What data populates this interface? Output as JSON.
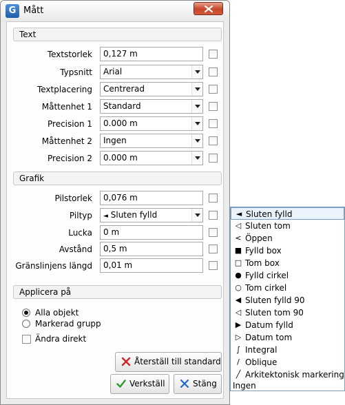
{
  "window": {
    "title": "Mått",
    "app_icon_letter": "G"
  },
  "sections": {
    "text": "Text",
    "grafik": "Grafik",
    "applicera": "Applicera på"
  },
  "text_rows": {
    "textstorlek": {
      "label": "Textstorlek",
      "value": "0,127 m"
    },
    "typsnitt": {
      "label": "Typsnitt",
      "value": "Arial"
    },
    "textplacering": {
      "label": "Textplacering",
      "value": "Centrerad"
    },
    "mattenhet1": {
      "label": "Måttenhet 1",
      "value": "Standard"
    },
    "precision1": {
      "label": "Precision 1",
      "value": "0.000 m"
    },
    "mattenhet2": {
      "label": "Måttenhet 2",
      "value": "Ingen"
    },
    "precision2": {
      "label": "Precision 2",
      "value": "0.000 m"
    }
  },
  "grafik_rows": {
    "pilstorlek": {
      "label": "Pilstorlek",
      "value": "0,076 m"
    },
    "piltyp": {
      "label": "Piltyp",
      "value": "Sluten fylld",
      "icon": "◄"
    },
    "lucka": {
      "label": "Lucka",
      "value": "0 m"
    },
    "avstand": {
      "label": "Avstånd",
      "value": "0,5 m"
    },
    "granslinje": {
      "label": "Gränslinjens längd",
      "value": "0,01 m"
    }
  },
  "apply": {
    "alla": "Alla objekt",
    "markerad": "Markerad grupp",
    "andra": "Ändra direkt",
    "selected": "alla"
  },
  "buttons": {
    "reset": "Återställ till standard",
    "apply": "Verkställ",
    "close": "Stäng"
  },
  "colors": {
    "reset_icon": "#d32222",
    "apply_icon": "#2e9a2e",
    "close_icon": "#2266cc"
  },
  "arrow_types": [
    {
      "label": "Sluten fylld",
      "icon": "◄",
      "selected": true
    },
    {
      "label": "Sluten tom",
      "icon": "◁"
    },
    {
      "label": "Öppen",
      "icon": "<"
    },
    {
      "label": "Fylld box",
      "icon": "■"
    },
    {
      "label": "Tom box",
      "icon": "□"
    },
    {
      "label": "Fylld cirkel",
      "icon": "●"
    },
    {
      "label": "Tom cirkel",
      "icon": "○"
    },
    {
      "label": "Sluten fylld 90",
      "icon": "◀"
    },
    {
      "label": "Sluten tom 90",
      "icon": "◁"
    },
    {
      "label": "Datum fylld",
      "icon": "▶"
    },
    {
      "label": "Datum tom",
      "icon": "▷"
    },
    {
      "label": "Integral",
      "icon": "∫"
    },
    {
      "label": "Oblique",
      "icon": "/"
    },
    {
      "label": "Arkitektonisk markering",
      "icon": "╱"
    },
    {
      "label": "Ingen",
      "icon": ""
    }
  ]
}
